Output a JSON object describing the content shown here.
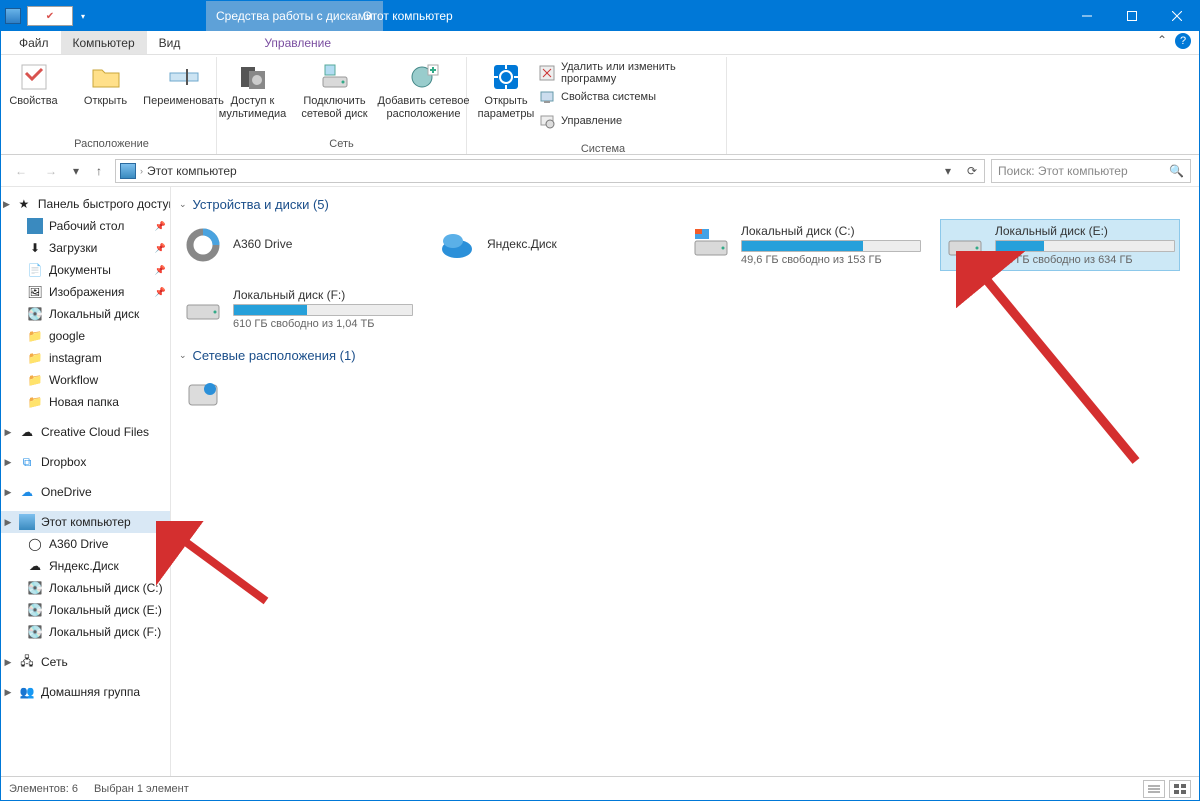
{
  "titlebar": {
    "context_tab": "Средства работы с дисками",
    "title": "Этот компьютер"
  },
  "tabs": {
    "file": "Файл",
    "computer": "Компьютер",
    "view": "Вид",
    "manage": "Управление"
  },
  "ribbon": {
    "location_group": "Расположение",
    "properties": "Свойства",
    "open": "Открыть",
    "rename": "Переименовать",
    "network_group": "Сеть",
    "media_access": "Доступ к\nмультимедиа",
    "net_drive": "Подключить\nсетевой диск",
    "add_net_loc": "Добавить сетевое\nрасположение",
    "system_group": "Система",
    "open_settings": "Открыть\nпараметры",
    "uninstall": "Удалить или изменить программу",
    "sys_props": "Свойства системы",
    "manage": "Управление"
  },
  "address": {
    "crumb": "Этот компьютер",
    "search_placeholder": "Поиск: Этот компьютер"
  },
  "sidebar": {
    "quick_access": "Панель быстрого доступа",
    "desktop": "Рабочий стол",
    "downloads": "Загрузки",
    "documents": "Документы",
    "pictures": "Изображения",
    "localdisk": "Локальный диск",
    "google": "google",
    "instagram": "instagram",
    "workflow": "Workflow",
    "newfolder": "Новая папка",
    "creative_cloud": "Creative Cloud Files",
    "dropbox": "Dropbox",
    "onedrive": "OneDrive",
    "this_pc": "Этот компьютер",
    "a360": "A360 Drive",
    "yandex": "Яндекс.Диск",
    "disk_c": "Локальный диск (C:)",
    "disk_e": "Локальный диск (E:)",
    "disk_f": "Локальный диск (F:)",
    "network": "Сеть",
    "homegroup": "Домашняя группа"
  },
  "content": {
    "devices_header": "Устройства и диски (5)",
    "netloc_header": "Сетевые расположения (1)",
    "a360": {
      "name": "A360 Drive"
    },
    "yandex": {
      "name": "Яндекс.Диск"
    },
    "disk_c": {
      "name": "Локальный диск (C:)",
      "sub": "49,6 ГБ свободно из 153 ГБ",
      "fill_pct": 68
    },
    "disk_e": {
      "name": "Локальный диск (E:)",
      "sub": "465 ГБ свободно из 634 ГБ",
      "fill_pct": 27
    },
    "disk_f": {
      "name": "Локальный диск (F:)",
      "sub": "610 ГБ свободно из 1,04 ТБ",
      "fill_pct": 41
    }
  },
  "statusbar": {
    "count": "Элементов: 6",
    "sel": "Выбран 1 элемент"
  }
}
